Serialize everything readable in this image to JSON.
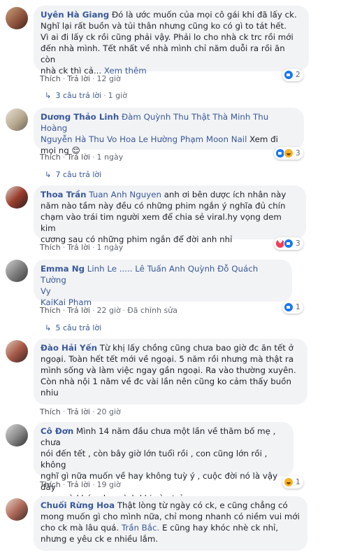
{
  "colors": {
    "link": "#385898",
    "bubble": "#f2f3f5",
    "muted": "#606770"
  },
  "comments": [
    {
      "author": "Uyên Hà Giang",
      "lines": [
        "Đó là ước muốn của mọi cô gái khi đã lấy ck.",
        "Nghĩ lại rất buồn và tủi thân nhưng cũng ko có gì to tát hết.",
        "Vì ai đi lấy ck rồi cũng phải vậy. Phải lo cho nhà ck trc rồi mới",
        "đến nhà mình. Tết nhất về nhà mình chỉ năm duỗi ra rồi ăn còn",
        "nhà ck thì cả..."
      ],
      "see_more": "Xem thêm",
      "like": "Thích",
      "reply": "Trả lời",
      "time": "12 giờ",
      "reactions": [
        "like"
      ],
      "reaction_count": "2",
      "replies": "3 câu trả lời",
      "replies_time": "1 giờ"
    },
    {
      "author": "Dương Thảo Linh",
      "mentions_line1": "Đàm Quỳnh Thu Thật Thà Minh Thu Hoàng",
      "mentions_line2": "Nguyễn Hà Thu Vo Hoa Le Hường Phạm Moon Nail",
      "tail": "Xem đi",
      "line3": "mọi ng 😌",
      "like": "Thích",
      "reply": "Trả lời",
      "time": "1 ngày",
      "reactions": [
        "like",
        "haha"
      ],
      "reaction_count": "3",
      "replies": "7 câu trả lời"
    },
    {
      "author": "Thoa Trần",
      "mention": "Tuan Anh Nguyen",
      "line1_tail": "anh ơi bên dược ích nhân này",
      "lines": [
        "năm nào tầm này đều có những phim ngắn ý nghĩa đủ chín",
        "chạm vào trái tim người xem để chia sẻ viral.hy vọng dem kim",
        "cương sau có những phim ngắn để đời anh nhỉ"
      ],
      "like": "Thích",
      "reply": "Trả lời",
      "time": "1 ngày",
      "reactions": [
        "love",
        "like"
      ],
      "reaction_count": "3"
    },
    {
      "author": "Emma Ng",
      "mentions_line1": "Linh Le ..... Lê Tuấn Anh Quỳnh Đỗ Quách Tường",
      "mentions_line2": "Vy",
      "mentions_line3": "KaiKai Pham",
      "like": "Thích",
      "reply": "Trả lời",
      "time": "22 giờ",
      "edited": "Đã chỉnh sửa",
      "reactions": [
        "like"
      ],
      "reaction_count": "1",
      "replies": "5 câu trả lời"
    },
    {
      "author": "Đào Hải Yến",
      "line1_tail": "Từ khị lấy chồng cũng chưa bao giờ đc ăn tết ở",
      "lines": [
        "ngoại. Toàn hết tết mới về ngoại. 5 năm rồi nhưng mà thật ra",
        "mình sống và làm việc ngay gần ngoại. Ra vào thường xuyên.",
        "Còn nhà nội 1 năm về đc vài lần nên cũng ko cảm thấy buồn",
        "nhiu"
      ],
      "like": "Thích",
      "reply": "Trả lời",
      "time": "20 giờ"
    },
    {
      "author": "Cô Đơn",
      "line1_tail": "Mình 14 năm đầu chưa một lần về thăm bố mẹ , chưa",
      "lines": [
        "nói đến tết , còn bây giờ lớn tuổi rồi , con cũng lớn rồi , không",
        "nghĩ gì nữa muốn về hay không tuỳ ý , cuộc đời nó là vậy đấy",
        "xem mà khóc cho mình khi còn trẻ ."
      ],
      "like": "Thích",
      "reply": "Trả lời",
      "time": "19 giờ",
      "reactions": [
        "haha"
      ],
      "reaction_count": "1"
    },
    {
      "author": "Chuối Rừng Hoa",
      "line1_tail": "Thật lòng từ ngày có ck, e cũng chẳng có",
      "line2": "mong muốn gì cho mình nữa, chỉ mong nhanh có niềm vui mới",
      "line3_head": "cho ck mà lâu quá.",
      "line3_mention": "Trần Bắc.",
      "line3_tail": "E cũng hay khóc nhè ck nhỉ,",
      "line4": "nhưng e yêu ck e nhiều lắm."
    }
  ]
}
